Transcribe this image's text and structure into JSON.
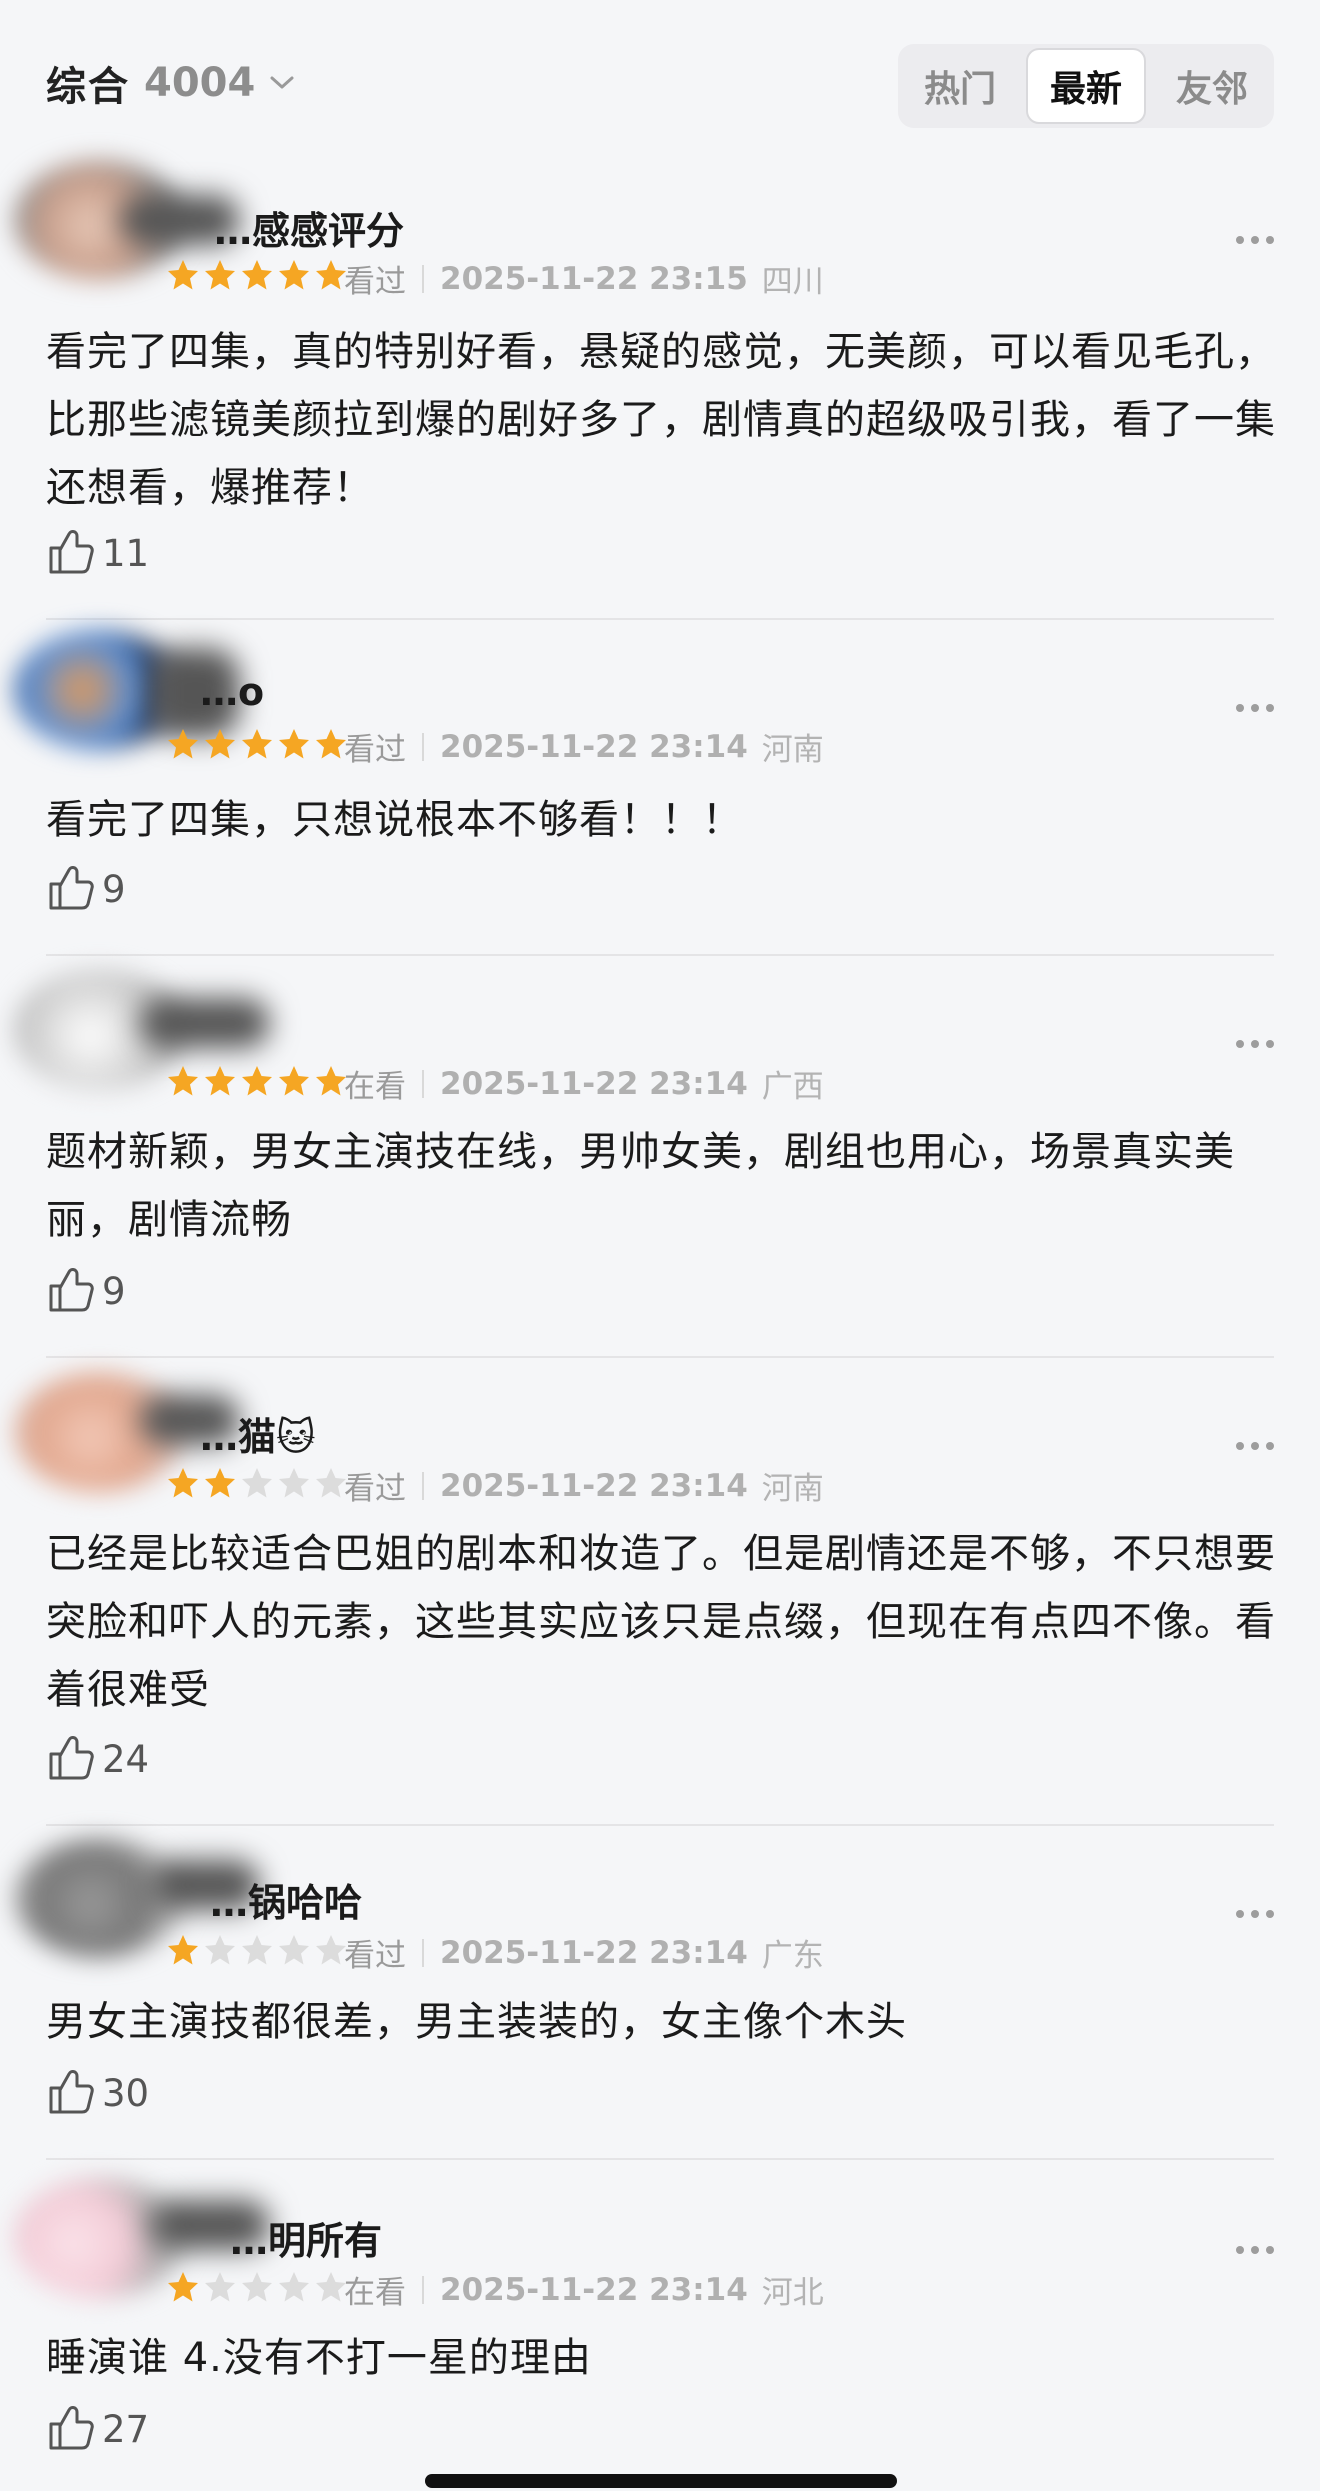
{
  "header": {
    "title": "综合",
    "count": "4004",
    "tabs": [
      {
        "label": "热门",
        "active": false
      },
      {
        "label": "最新",
        "active": true
      },
      {
        "label": "友邻",
        "active": false
      }
    ]
  },
  "colors": {
    "star_on": "#f5a623",
    "star_off": "#dcdcdc",
    "accent": "#111111"
  },
  "reviews": [
    {
      "name": "…感感评分",
      "rating": 5,
      "status": "看过",
      "time": "2025-11-22 23:15",
      "region": "四川",
      "text": "看完了四集，真的特别好看，悬疑的感觉，无美颜，可以看见毛孔，比那些滤镜美颜拉到爆的剧好多了，剧情真的超级吸引我，看了一集还想看，爆推荐！",
      "likes": "11"
    },
    {
      "name": "…o",
      "rating": 5,
      "status": "看过",
      "time": "2025-11-22 23:14",
      "region": "河南",
      "text": "看完了四集，只想说根本不够看！！！",
      "likes": "9"
    },
    {
      "name": "",
      "rating": 5,
      "status": "在看",
      "time": "2025-11-22 23:14",
      "region": "广西",
      "text": "题材新颖，男女主演技在线，男帅女美，剧组也用心，场景真实美丽，剧情流畅",
      "likes": "9"
    },
    {
      "name": "…猫🐱",
      "rating": 2,
      "status": "看过",
      "time": "2025-11-22 23:14",
      "region": "河南",
      "text": "已经是比较适合巴姐的剧本和妆造了。但是剧情还是不够，不只想要突脸和吓人的元素，这些其实应该只是点缀，但现在有点四不像。看着很难受",
      "likes": "24"
    },
    {
      "name": "…锅哈哈",
      "rating": 1,
      "status": "看过",
      "time": "2025-11-22 23:14",
      "region": "广东",
      "text": "男女主演技都很差，男主装装的，女主像个木头",
      "likes": "30"
    },
    {
      "name": "…明所有",
      "rating": 1,
      "status": "在看",
      "time": "2025-11-22 23:14",
      "region": "河北",
      "text": "睡演谁 4.没有不打一星的理由",
      "likes": "27"
    }
  ]
}
